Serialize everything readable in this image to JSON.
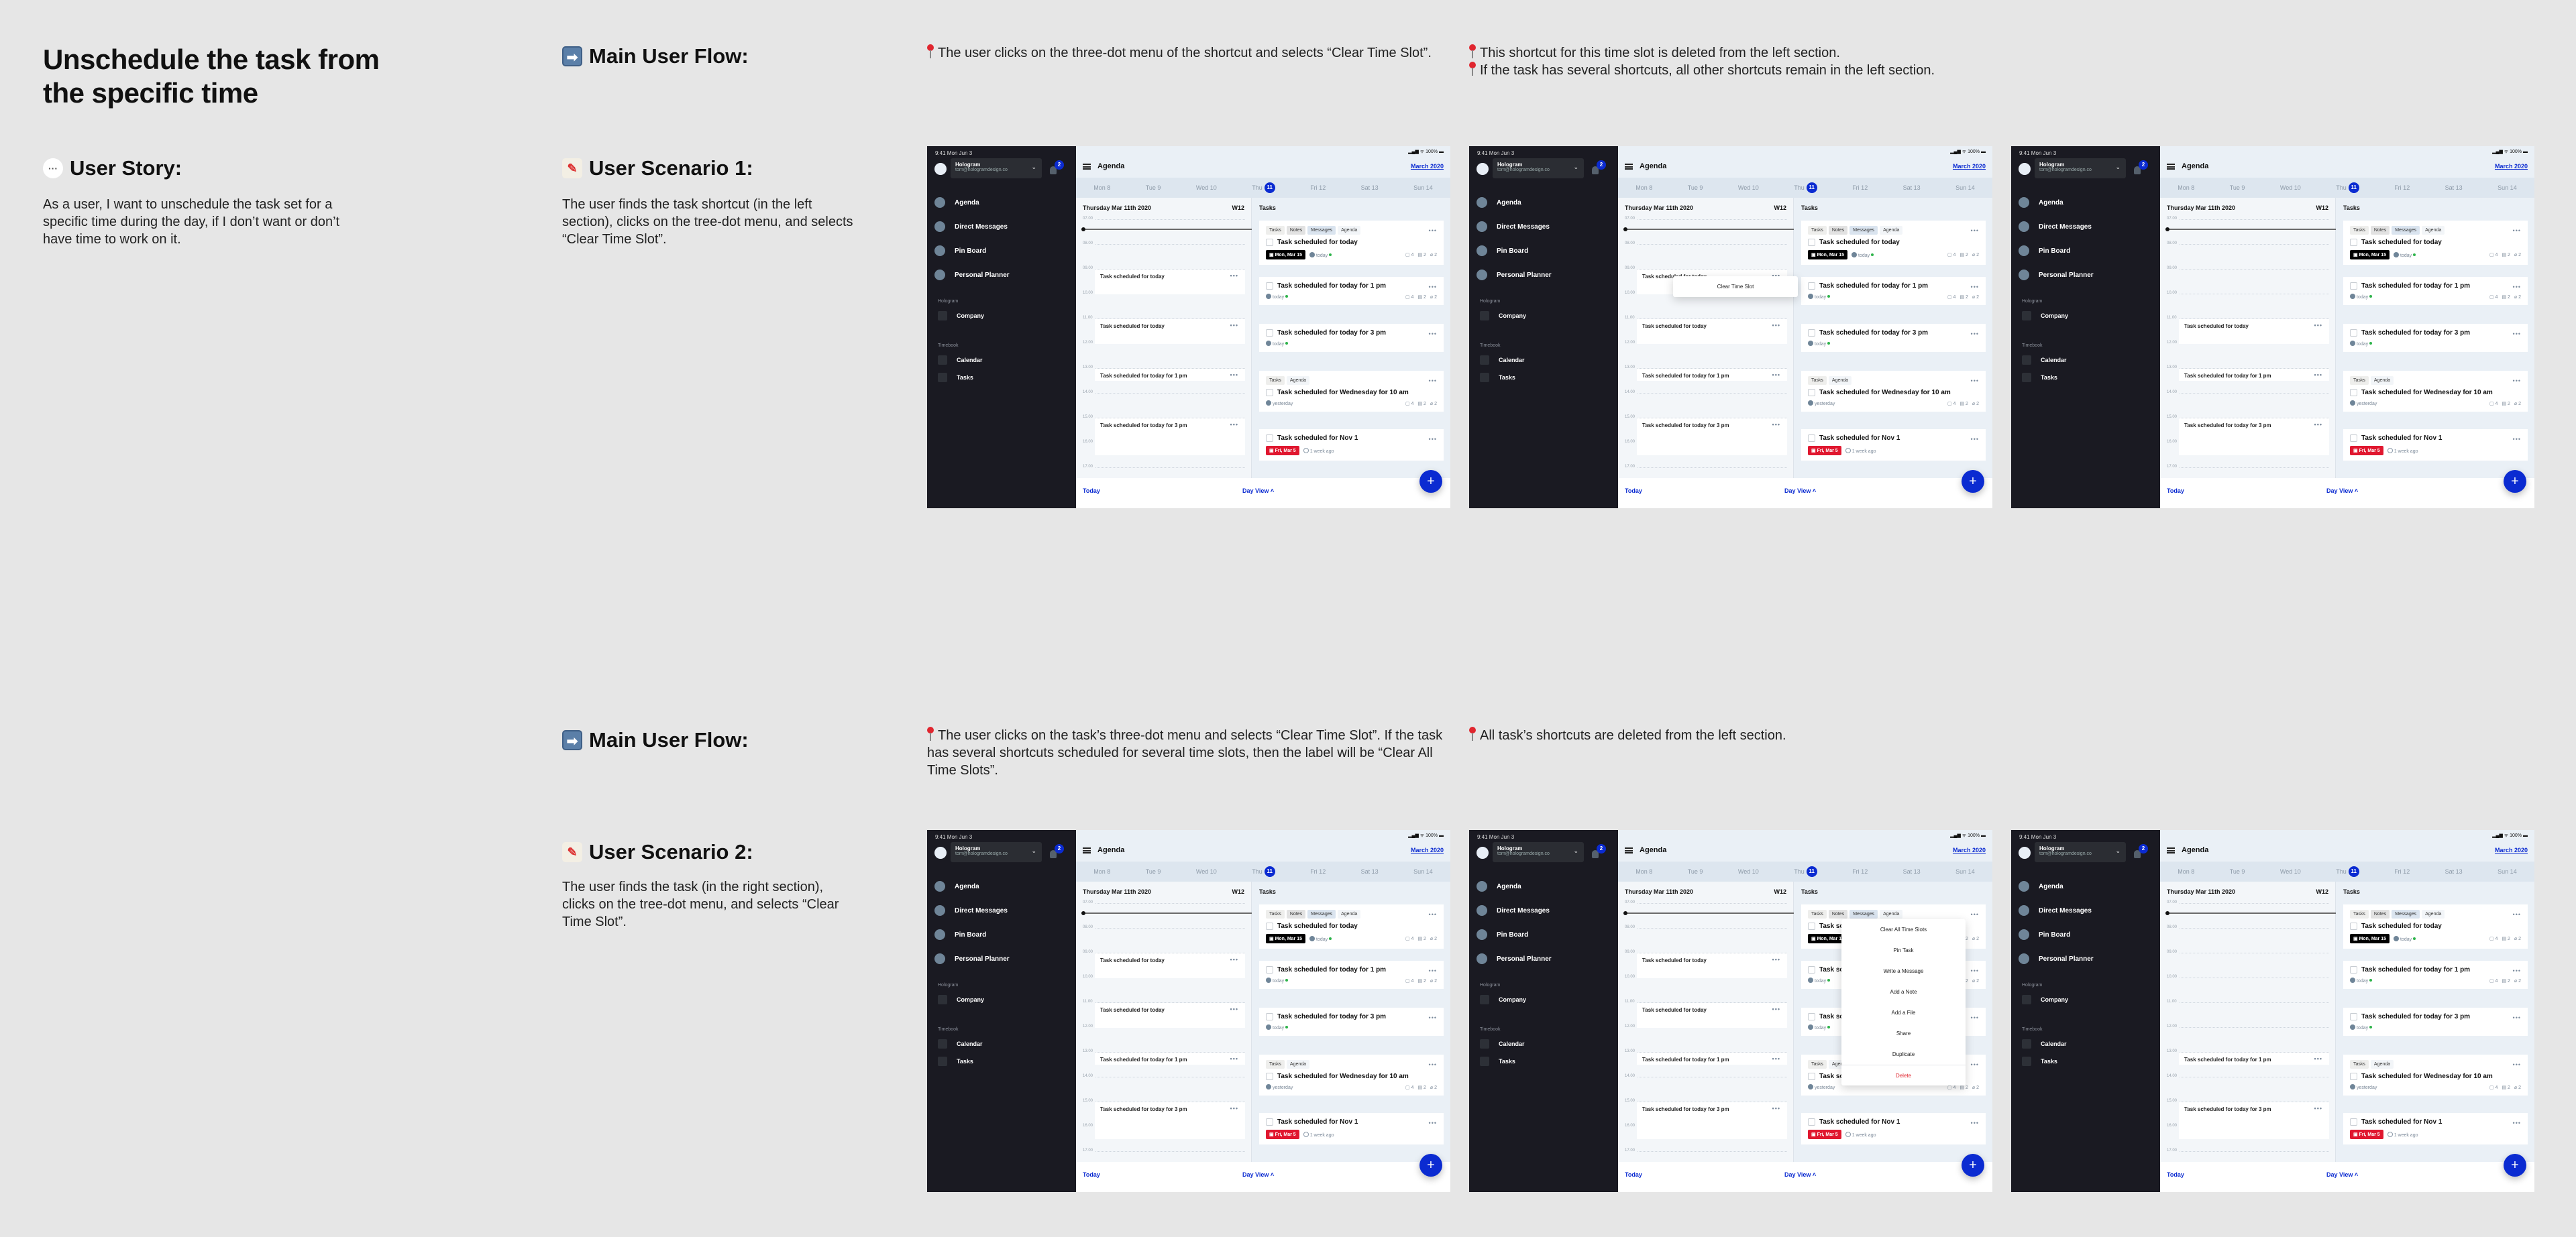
{
  "page_title": "Unschedule the task from the specific time",
  "user_story": {
    "heading": "User Story:",
    "icon": "speech-balloon-icon",
    "text": "As a user, I want to unschedule the task set for a specific time during the day, if I don’t want or don’t have time to work on it."
  },
  "flows": [
    {
      "main_flow_heading": "Main User Flow:",
      "scenario_heading": "User Scenario 1:",
      "scenario_text": "The user finds the task shortcut (in the left section), clicks on the tree-dot menu, and selects “Clear Time Slot”.",
      "step_notes": [
        [
          "The user clicks on the three-dot menu of the shortcut and selects “Clear Time Slot”."
        ],
        [
          "This shortcut for this time slot is deleted from the left section.",
          "If the task has several shortcuts, all other shortcuts remain in the left section."
        ]
      ]
    },
    {
      "main_flow_heading": "Main User Flow:",
      "scenario_heading": "User Scenario 2:",
      "scenario_text": "The user finds the task (in the right section), clicks on the tree-dot menu, and selects “Clear Time Slot”.",
      "step_notes": [
        [
          "The user clicks on the task’s three-dot menu and selects “Clear Time Slot”. If the task has several shortcuts scheduled for several time slots, then the label will be “Clear All Time Slots”."
        ],
        [
          "All task’s shortcuts are deleted from the left section."
        ]
      ]
    }
  ],
  "app": {
    "status_time": "9:41  Mon Jun 3",
    "status_right": "▂▄▆ ᯤ 100% ▬",
    "workspace_name": "Hologram",
    "workspace_email": "tom@hologramdesign.co",
    "notification_count": "2",
    "nav": [
      "Agenda",
      "Direct Messages",
      "Pin Board",
      "Personal Planner"
    ],
    "section_hologram": "Hologram",
    "hologram_items": [
      "Company"
    ],
    "section_timebook": "Timebook",
    "timebook_items": [
      "Calendar",
      "Tasks"
    ],
    "header_title": "Agenda",
    "month_link": "March 2020",
    "days": [
      "Mon 8",
      "Tue 9",
      "Wed 10",
      "Thu",
      "Fri 12",
      "Sat 13",
      "Sun 14"
    ],
    "selected_day_number": "11",
    "agenda_date": "Thursday Mar 11th 2020",
    "week": "W12",
    "hours": [
      "07.00",
      "08.00",
      "09.00",
      "10.00",
      "11.00",
      "12.00",
      "13.00",
      "14.00",
      "15.00",
      "16.00",
      "17.00"
    ],
    "slot_titles": {
      "s9": "Task scheduled for today",
      "s11": "Task scheduled for today",
      "s13": "Task scheduled for today for 1 pm",
      "s15": "Task scheduled for today for 3 pm"
    },
    "tasks_header": "Tasks",
    "tags_full": [
      "Tasks",
      "Notes",
      "Messages",
      "Agenda"
    ],
    "tags_short": [
      "Tasks",
      "Agenda"
    ],
    "cards": [
      {
        "title": "Task scheduled for today",
        "date_pill": "Mon, Mar 15",
        "when": "today",
        "comments": "4",
        "notes": "2",
        "files": "2"
      },
      {
        "title": "Task scheduled for today for 1 pm",
        "when": "today",
        "comments": "4",
        "notes": "2",
        "files": "2"
      },
      {
        "title": "Task scheduled for today for 3 pm",
        "when": "today"
      },
      {
        "title": "Task scheduled for Wednesday for 10 am",
        "when": "yesterday",
        "comments": "4",
        "notes": "2",
        "files": "2"
      },
      {
        "title": "Task scheduled for Nov 1",
        "date_pill": "Fri, Mar 5",
        "when": "1 week ago"
      }
    ],
    "bottom_today": "Today",
    "bottom_dayview": "Day View ˄",
    "fab": "+",
    "clear_time_slot": "Clear Time Slot",
    "task_menu": [
      "Clear All Time Slots",
      "Pin Task",
      "Write a Message",
      "Add a Note",
      "Add a File",
      "Share",
      "Duplicate",
      "Delete"
    ]
  }
}
